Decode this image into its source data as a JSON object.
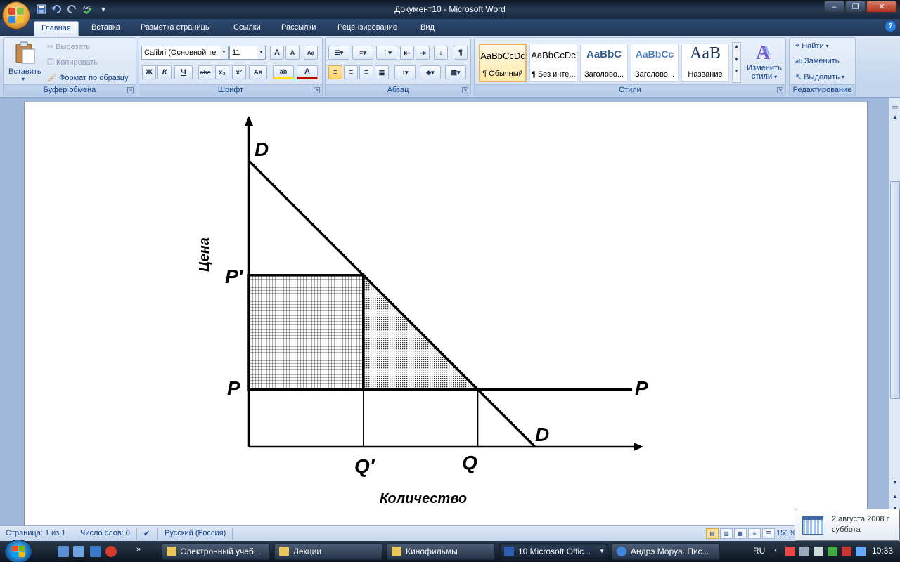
{
  "window": {
    "title": "Документ10 - Microsoft Word",
    "controls": {
      "minimize": "‒",
      "restore": "❐",
      "close": "✕"
    }
  },
  "qat": [
    "save-icon",
    "undo-icon",
    "redo-icon",
    "spelling-icon",
    "customize-icon"
  ],
  "tabs": [
    "Главная",
    "Вставка",
    "Разметка страницы",
    "Ссылки",
    "Рассылки",
    "Рецензирование",
    "Вид"
  ],
  "ribbon": {
    "clipboard": {
      "label": "Буфер обмена",
      "paste": "Вставить",
      "cut": "Вырезать",
      "copy": "Копировать",
      "format_painter": "Формат по образцу"
    },
    "font": {
      "label": "Шрифт",
      "font_name": "Calibri (Основной те",
      "font_size": "11",
      "grow": "A",
      "shrink": "A",
      "clear": "Aa",
      "bold": "Ж",
      "italic": "К",
      "underline": "Ч",
      "strike": "abe",
      "subscript": "x₂",
      "superscript": "x²",
      "case": "Aa",
      "highlight": "ab",
      "font_color": "A"
    },
    "paragraph": {
      "label": "Абзац",
      "pilcrow": "¶"
    },
    "styles": {
      "label": "Стили",
      "items": [
        {
          "sample": "AaBbCcDc",
          "name": "¶ Обычный"
        },
        {
          "sample": "AaBbCcDc",
          "name": "¶ Без инте..."
        },
        {
          "sample": "AaBbC",
          "name": "Заголово..."
        },
        {
          "sample": "AaBbCc",
          "name": "Заголово..."
        },
        {
          "sample": "AaB",
          "name": "Название"
        }
      ],
      "change_styles_1": "Изменить",
      "change_styles_2": "стили"
    },
    "editing": {
      "label": "Редактирование",
      "find": "Найти",
      "replace": "Заменить",
      "select": "Выделить"
    }
  },
  "chart_data": {
    "type": "diagram",
    "ylabel": "Цена",
    "xlabel": "Количество",
    "labels": {
      "demand_top": "D",
      "demand_bottom": "D",
      "price_high": "P′",
      "price": "P",
      "price_line": "P",
      "quantity_low": "Q′",
      "quantity": "Q"
    },
    "demand_line": [
      [
        0,
        100
      ],
      [
        100,
        0
      ]
    ],
    "price_levels": {
      "p_prime": 60,
      "p": 20
    },
    "quantity_levels": {
      "q_prime": 40,
      "q": 80
    }
  },
  "statusbar": {
    "page": "Страница: 1 из 1",
    "words": "Число слов: 0",
    "language": "Русский (Россия)",
    "zoom": "151%"
  },
  "taskbar": {
    "tasks": [
      {
        "label": "Электронный учеб...",
        "color": "#e8c55a"
      },
      {
        "label": "Лекции",
        "color": "#e8c55a"
      },
      {
        "label": "Кинофильмы",
        "color": "#e8c55a"
      },
      {
        "label": "10 Microsoft Offic...",
        "color": "#2f5fb3"
      },
      {
        "label": "Андрэ Моруа. Пис...",
        "color": "#3f86d8"
      }
    ],
    "language": "RU",
    "time": "10:33"
  },
  "date_tooltip": {
    "date": "2 августа 2008 г.",
    "weekday": "суббота"
  }
}
